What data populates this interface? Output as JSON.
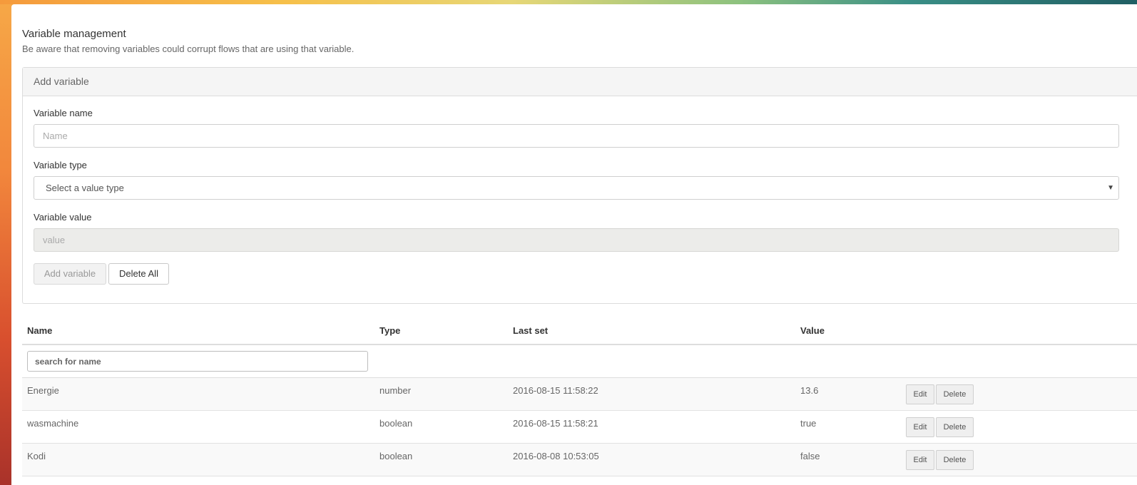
{
  "page": {
    "title": "Variable management",
    "subtitle": "Be aware that removing variables could corrupt flows that are using that variable."
  },
  "add_panel": {
    "heading": "Add variable",
    "name_label": "Variable name",
    "name_placeholder": "Name",
    "name_value": "",
    "type_label": "Variable type",
    "type_selected": "Select a value type",
    "value_label": "Variable value",
    "value_placeholder": "value",
    "value_value": "",
    "add_button": "Add variable",
    "delete_all_button": "Delete All"
  },
  "table": {
    "headers": {
      "name": "Name",
      "type": "Type",
      "last_set": "Last set",
      "value": "Value"
    },
    "search_placeholder": "search for name",
    "search_value": "",
    "edit_label": "Edit",
    "delete_label": "Delete",
    "rows": [
      {
        "name": "Energie",
        "type": "number",
        "last_set": "2016-08-15 11:58:22",
        "value": "13.6"
      },
      {
        "name": "wasmachine",
        "type": "boolean",
        "last_set": "2016-08-15 11:58:21",
        "value": "true"
      },
      {
        "name": "Kodi",
        "type": "boolean",
        "last_set": "2016-08-08 10:53:05",
        "value": "false"
      }
    ]
  },
  "colors": {
    "background_orange": "#f2873c",
    "panel_heading_bg": "#f5f5f5",
    "disabled_input_bg": "#ececea"
  },
  "icons": {
    "select_caret": "caret-down-icon"
  }
}
